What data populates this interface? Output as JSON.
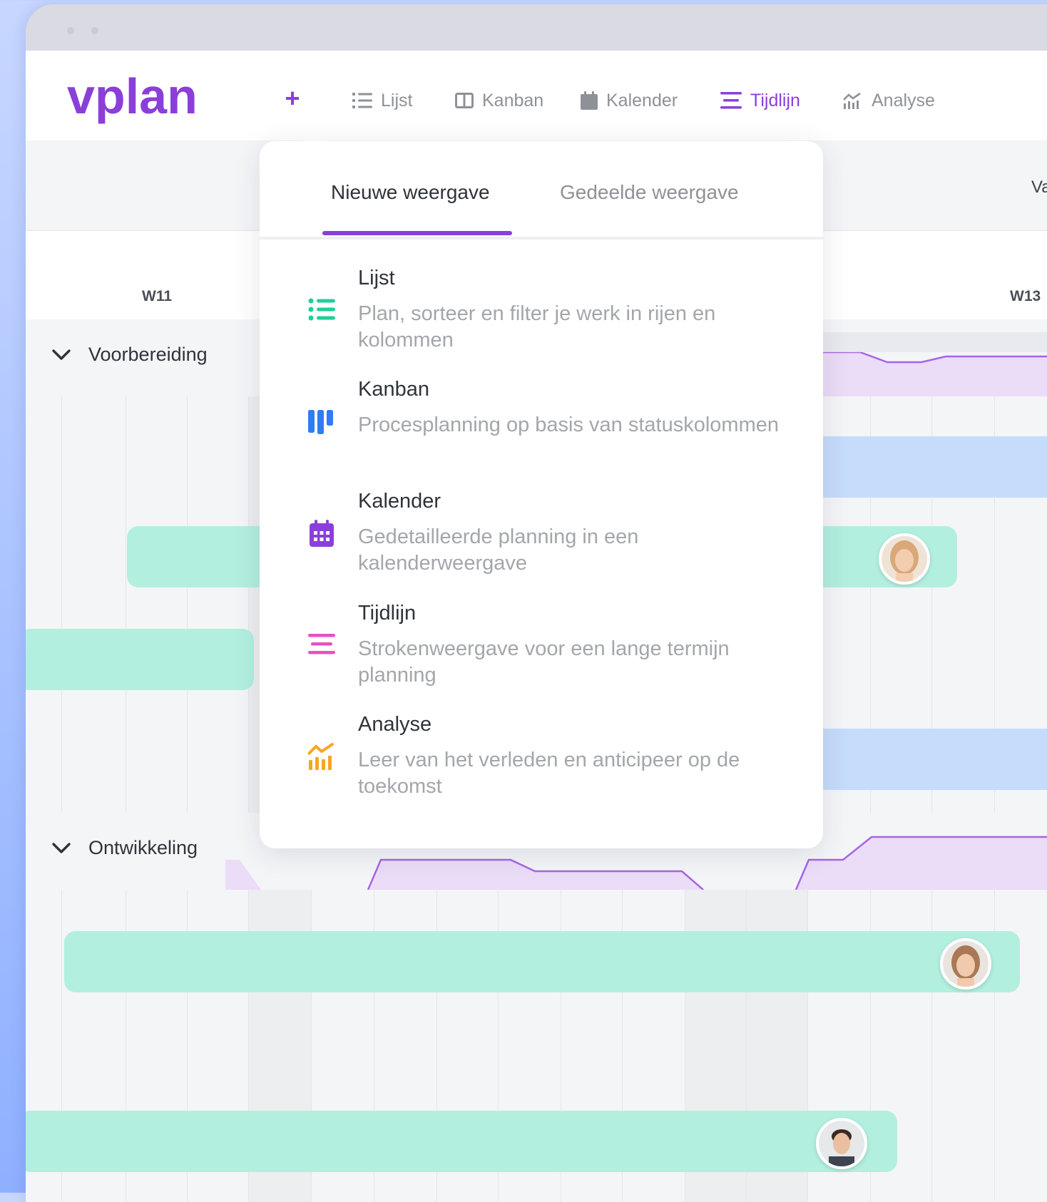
{
  "app": {
    "logo_text": "vplan",
    "brand_color": "#8b3fd9"
  },
  "nav": {
    "add_icon": "plus-icon",
    "items": [
      {
        "label": "Lijst",
        "icon": "list-icon"
      },
      {
        "label": "Kanban",
        "icon": "columns-icon"
      },
      {
        "label": "Kalender",
        "icon": "calendar-icon"
      },
      {
        "label": "Tijdlijn",
        "icon": "timeline-icon",
        "active": true
      },
      {
        "label": "Analyse",
        "icon": "analytics-icon"
      }
    ]
  },
  "subbar": {
    "right_text": "Va"
  },
  "timeline": {
    "weeks": [
      "W11",
      "W13"
    ],
    "groups": [
      {
        "label": "Voorbereiding",
        "icon": "chevron-down-icon"
      },
      {
        "label": "Ontwikkeling",
        "icon": "chevron-down-icon"
      }
    ]
  },
  "popup": {
    "tabs": [
      {
        "label": "Nieuwe weergave",
        "active": true
      },
      {
        "label": "Gedeelde weergave",
        "active": false
      }
    ],
    "views": [
      {
        "title": "Lijst",
        "description": "Plan, sorteer en filter je werk in rijen en kolommen",
        "icon": "list-icon",
        "color": "#1fcf9a"
      },
      {
        "title": "Kanban",
        "description": "Procesplanning op basis van statuskolommen",
        "icon": "kanban-icon",
        "color": "#2f7cf6"
      },
      {
        "title": "Kalender",
        "description": "Gedetailleerde planning in een kalenderweergave",
        "icon": "calendar-icon",
        "color": "#8b3fd9"
      },
      {
        "title": "Tijdlijn",
        "description": "Strokenweergave voor een lange termijn planning",
        "icon": "timeline-icon",
        "color": "#e94fc2"
      },
      {
        "title": "Analyse",
        "description": "Leer van het verleden en anticipeer op de toekomst",
        "icon": "analytics-icon",
        "color": "#f5a623"
      }
    ]
  }
}
